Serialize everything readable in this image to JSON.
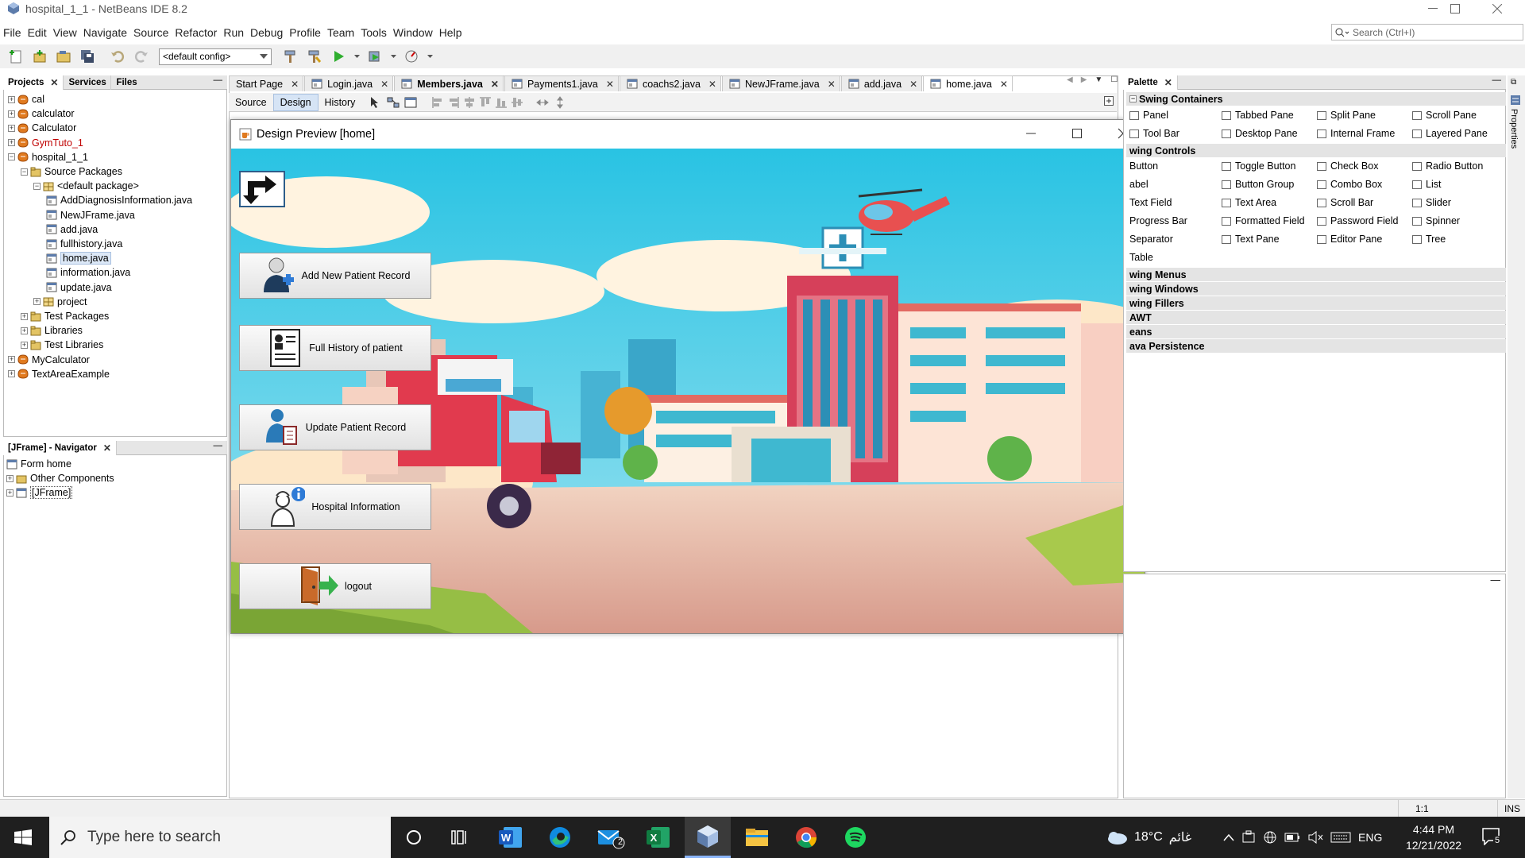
{
  "window": {
    "title": "hospital_1_1 - NetBeans IDE 8.2"
  },
  "menu": [
    "File",
    "Edit",
    "View",
    "Navigate",
    "Source",
    "Refactor",
    "Run",
    "Debug",
    "Profile",
    "Team",
    "Tools",
    "Window",
    "Help"
  ],
  "search": {
    "placeholder": "Search (Ctrl+I)"
  },
  "toolbar": {
    "config": "<default config>"
  },
  "projects_panel": {
    "tabs": [
      "Projects",
      "Services",
      "Files"
    ],
    "tree": [
      {
        "label": "cal",
        "level": 0,
        "icon": "project-icon"
      },
      {
        "label": "calculator",
        "level": 0,
        "icon": "project-icon"
      },
      {
        "label": "Calculator",
        "level": 0,
        "icon": "project-icon"
      },
      {
        "label": "GymTuto_1",
        "level": 0,
        "icon": "project-icon",
        "color": "#c00000"
      },
      {
        "label": "hospital_1_1",
        "level": 0,
        "icon": "project-icon"
      },
      {
        "label": "Source Packages",
        "level": 1,
        "icon": "folder-icon"
      },
      {
        "label": "<default package>",
        "level": 2,
        "icon": "package-icon"
      },
      {
        "label": "AddDiagnosisInformation.java",
        "level": 3,
        "icon": "java-form-icon"
      },
      {
        "label": "NewJFrame.java",
        "level": 3,
        "icon": "java-form-icon"
      },
      {
        "label": "add.java",
        "level": 3,
        "icon": "java-form-icon"
      },
      {
        "label": "fullhistory.java",
        "level": 3,
        "icon": "java-form-icon"
      },
      {
        "label": "home.java",
        "level": 3,
        "icon": "java-form-icon",
        "selected": true
      },
      {
        "label": "information.java",
        "level": 3,
        "icon": "java-form-icon"
      },
      {
        "label": "update.java",
        "level": 3,
        "icon": "java-form-icon"
      },
      {
        "label": "project",
        "level": 2,
        "icon": "package-icon"
      },
      {
        "label": "Test Packages",
        "level": 1,
        "icon": "folder-icon"
      },
      {
        "label": "Libraries",
        "level": 1,
        "icon": "folder-icon"
      },
      {
        "label": "Test Libraries",
        "level": 1,
        "icon": "folder-icon"
      },
      {
        "label": "MyCalculator",
        "level": 0,
        "icon": "project-icon"
      },
      {
        "label": "TextAreaExample",
        "level": 0,
        "icon": "project-icon"
      }
    ]
  },
  "navigator": {
    "title": "[JFrame] - Navigator",
    "tree": [
      {
        "label": "Form home",
        "level": 0
      },
      {
        "label": "Other Components",
        "level": 0
      },
      {
        "label": "[JFrame]",
        "level": 0
      }
    ]
  },
  "editor_tabs": [
    {
      "label": "Start Page",
      "active": false
    },
    {
      "label": "Login.java",
      "active": false
    },
    {
      "label": "Members.java",
      "active": false,
      "bold": true
    },
    {
      "label": "Payments1.java",
      "active": false
    },
    {
      "label": "coachs2.java",
      "active": false
    },
    {
      "label": "NewJFrame.java",
      "active": false
    },
    {
      "label": "add.java",
      "active": false
    },
    {
      "label": "home.java",
      "active": true
    }
  ],
  "design_toolbar": {
    "source": "Source",
    "design": "Design",
    "history": "History"
  },
  "preview": {
    "title": "Design Preview [home]",
    "buttons": [
      {
        "label": "Add New Patient Record",
        "icon": "doctor-plus-icon"
      },
      {
        "label": "Full History of patient",
        "icon": "id-card-icon"
      },
      {
        "label": "Update Patient Record",
        "icon": "person-clipboard-icon"
      },
      {
        "label": "Hospital Information",
        "icon": "nurse-info-icon"
      },
      {
        "label": "logout",
        "icon": "exit-door-icon"
      }
    ]
  },
  "palette": {
    "title": "Palette",
    "categories": [
      "Swing Containers",
      "wing Controls",
      "wing Menus",
      "wing Windows",
      "wing Fillers",
      "AWT",
      "eans",
      "ava Persistence"
    ],
    "containers": [
      "Panel",
      "Tabbed Pane",
      "Split Pane",
      "Scroll Pane",
      "Tool Bar",
      "Desktop Pane",
      "Internal Frame",
      "Layered Pane"
    ],
    "controls": [
      "Button",
      "Toggle Button",
      "Check Box",
      "Radio Button",
      "abel",
      "Button Group",
      "Combo Box",
      "List",
      "Text Field",
      "Text Area",
      "Scroll Bar",
      "Slider",
      "Progress Bar",
      "Formatted Field",
      "Password Field",
      "Spinner",
      "Separator",
      "Text Pane",
      "Editor Pane",
      "Tree",
      "Table"
    ]
  },
  "properties_label": "Properties",
  "status": {
    "position": "1:1",
    "mode": "INS"
  },
  "taskbar": {
    "search_placeholder": "Type here to search",
    "weather": "18°C",
    "weather_desc": "غائم",
    "lang": "ENG",
    "time": "4:44 PM",
    "date": "12/21/2022",
    "mail_badge": "2",
    "notif_badge": "5"
  }
}
